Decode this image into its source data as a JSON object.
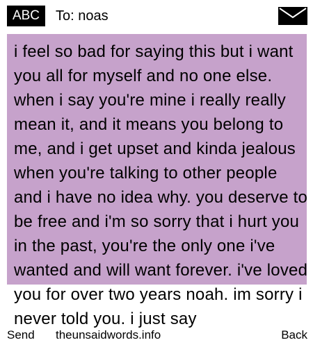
{
  "header": {
    "input_mode": "ABC",
    "to_label": "To: noas",
    "icon": "envelope-icon"
  },
  "message": {
    "text": "i feel so bad for saying this but i want you all for myself and no one else. when i say you're mine i really really mean it, and it means you belong to me, and i get upset and kinda jealous when you're talking to other people and i have no idea why. you deserve to be free and i'm so sorry that i hurt you in the past, you're the only one i've wanted and will want forever. i've loved you for over two years noah. im sorry i never told you. i just say"
  },
  "softkeys": {
    "left": "Send",
    "center": "theunsaidwords.info",
    "right": "Back"
  },
  "colors": {
    "highlight": "#c6a2cb"
  }
}
